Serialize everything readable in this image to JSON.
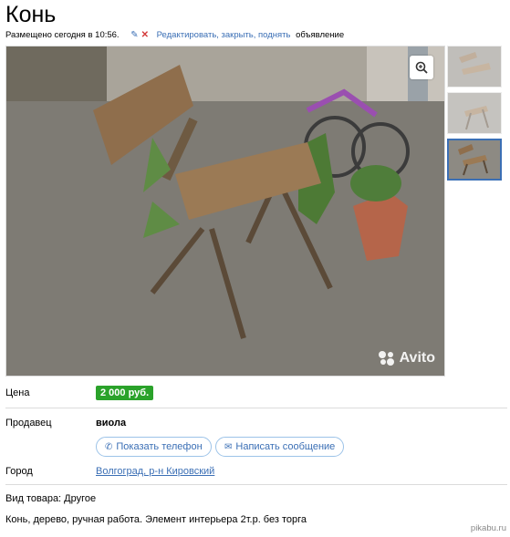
{
  "listing": {
    "title": "Конь",
    "posted": "Размещено сегодня в 10:56.",
    "edit_link": "Редактировать, закрыть, поднять",
    "edit_suffix": "объявление",
    "watermark": "Avito"
  },
  "details": {
    "price_label": "Цена",
    "price_value": "2 000 руб.",
    "seller_label": "Продавец",
    "seller_name": "виола",
    "show_phone_label": "Показать телефон",
    "write_message_label": "Написать сообщение",
    "city_label": "Город",
    "city_value": "Волгоград, р-н Кировский"
  },
  "description": {
    "category": "Вид товара: Другое",
    "text": "Конь, дерево, ручная работа. Элемент интерьера 2т.р. без торга"
  },
  "footer": {
    "credit": "pikabu.ru"
  },
  "colors": {
    "link": "#3b6fb5",
    "price_badge": "#2aa22a",
    "delete_icon": "#d43a3a"
  },
  "icons": [
    "pencil-icon",
    "close-icon",
    "zoom-icon",
    "phone-icon",
    "envelope-icon",
    "avito-logo-icon"
  ]
}
